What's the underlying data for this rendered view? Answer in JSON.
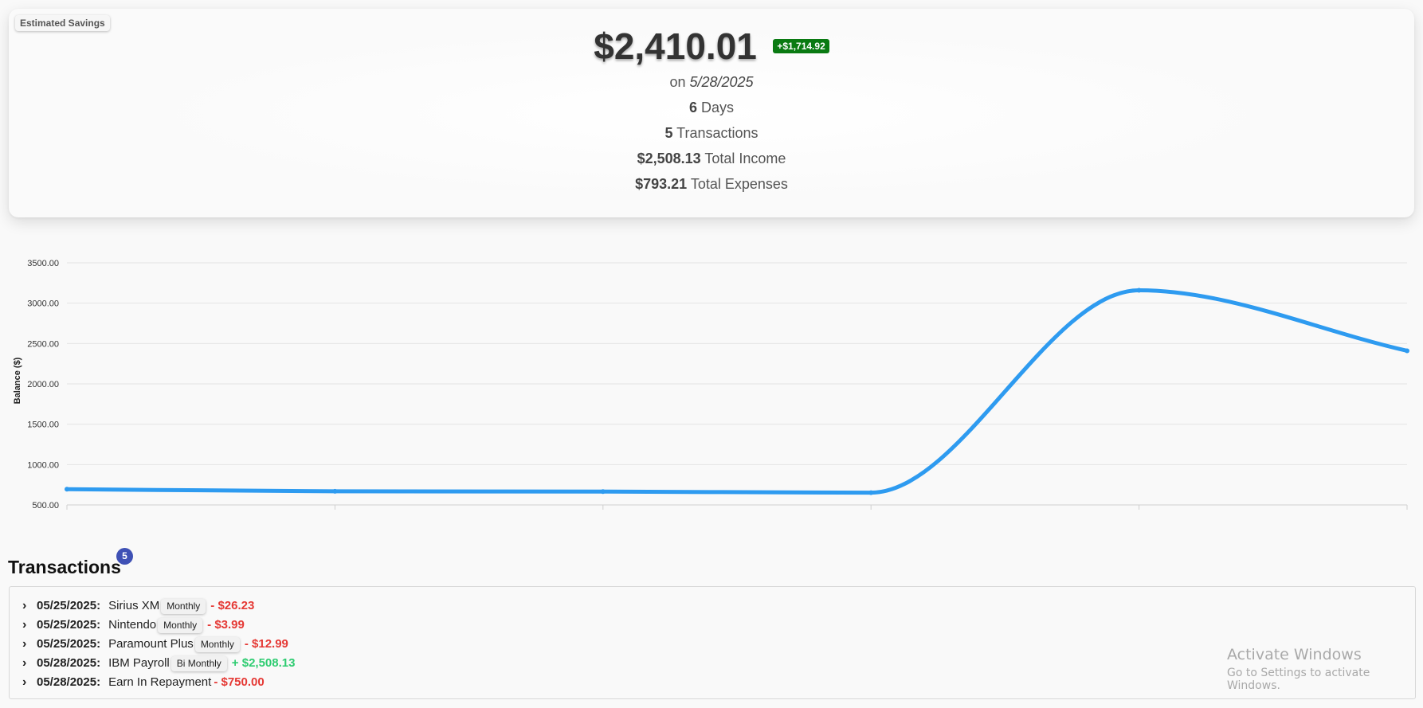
{
  "summary": {
    "tag": "Estimated Savings",
    "amount": "$2,410.01",
    "delta": "+$1,714.92",
    "on_prefix": "on",
    "date": "5/28/2025",
    "days_value": "6",
    "days_label": "Days",
    "transactions_value": "5",
    "transactions_label": "Transactions",
    "income_value": "$2,508.13",
    "income_label": "Total Income",
    "expenses_value": "$793.21",
    "expenses_label": "Total Expenses"
  },
  "chart_data": {
    "type": "line",
    "ylabel": "Balance ($)",
    "xlabel": "",
    "ylim": [
      500,
      3500
    ],
    "yticks": [
      "3500.00",
      "3000.00",
      "2500.00",
      "2000.00",
      "1500.00",
      "1000.00",
      "500.00"
    ],
    "grid": true,
    "line_color": "#2e9bf0",
    "series": [
      {
        "values": [
          695.22,
          669.0,
          665.0,
          652.0,
          3160.1,
          2410.01
        ]
      }
    ]
  },
  "transactions": {
    "title": "Transactions",
    "count": "5",
    "items": [
      {
        "date": "05/25/2025:",
        "name": "Sirius XM",
        "frequency": "Monthly",
        "amount": "- $26.23",
        "kind": "neg"
      },
      {
        "date": "05/25/2025:",
        "name": "Nintendo",
        "frequency": "Monthly",
        "amount": "- $3.99",
        "kind": "neg"
      },
      {
        "date": "05/25/2025:",
        "name": "Paramount Plus",
        "frequency": "Monthly",
        "amount": "- $12.99",
        "kind": "neg"
      },
      {
        "date": "05/28/2025:",
        "name": "IBM Payroll",
        "frequency": "Bi Monthly",
        "amount": "+ $2,508.13",
        "kind": "pos"
      },
      {
        "date": "05/28/2025:",
        "name": "Earn In Repayment",
        "frequency": "",
        "amount": "- $750.00",
        "kind": "neg"
      }
    ]
  },
  "watermark": {
    "line1": "Activate Windows",
    "line2": "Go to Settings to activate Windows."
  }
}
